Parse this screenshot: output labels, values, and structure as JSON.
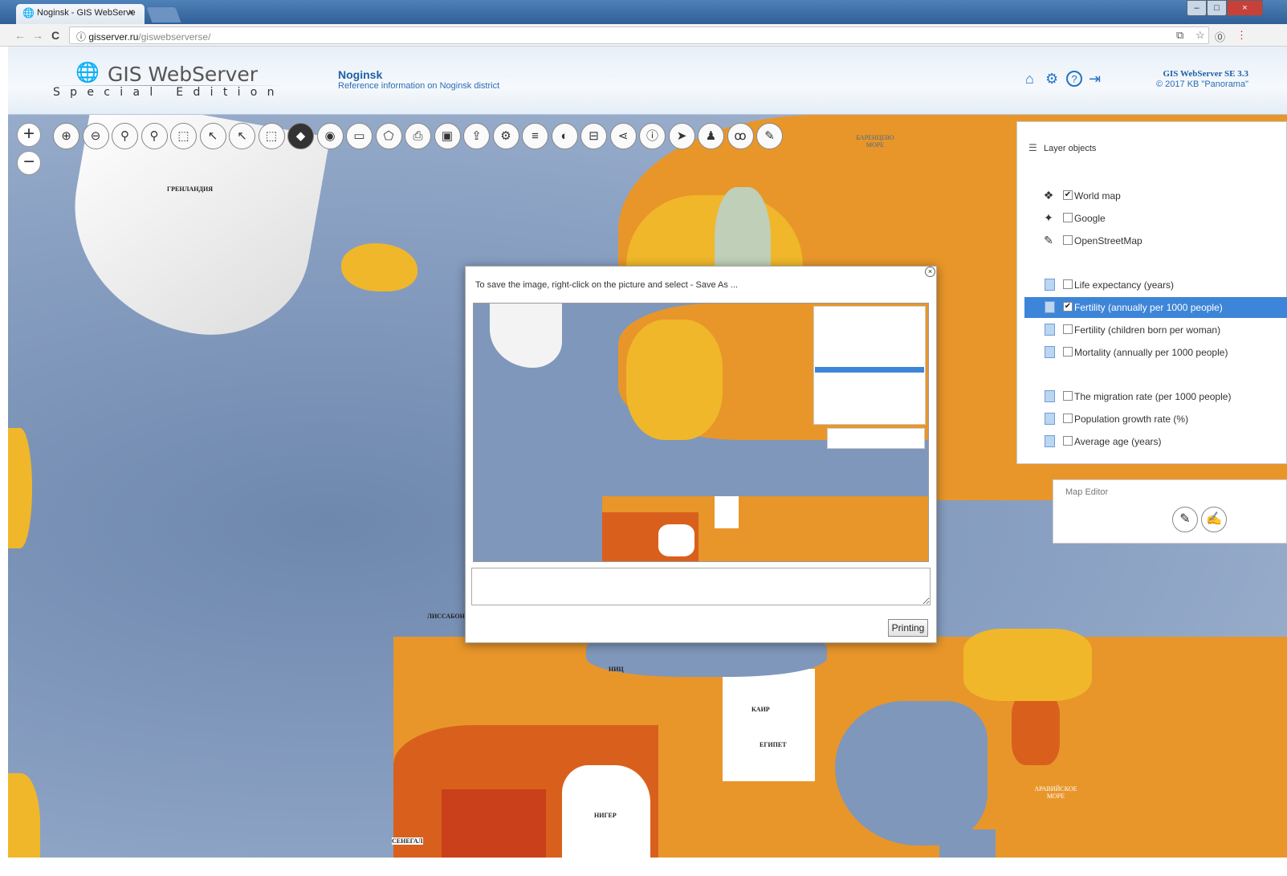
{
  "browser": {
    "tab_title": "Noginsk - GIS WebServe",
    "tab_icon": "map-globe-icon",
    "tab_close": "×",
    "url_host": "gisserver.ru",
    "url_path": "/giswebserverse/",
    "back": "←",
    "forward": "→",
    "reload": "C",
    "info": "ⓘ",
    "ext": "⧉",
    "star": "☆",
    "pin": "⓪",
    "menu": "⋮",
    "win_min": "–",
    "win_max": "□",
    "win_close": "×"
  },
  "header": {
    "logo_text": "GIS WebServer",
    "logo_sub": "Special Edition",
    "project_title": "Noginsk",
    "project_subtitle": "Reference information on Noginsk district",
    "icons": [
      "home-icon",
      "gear-icon",
      "help-icon",
      "logout-icon"
    ],
    "icon_glyphs": [
      "⌂",
      "⚙",
      "?",
      "⇥"
    ],
    "version_title": "GIS WebServer SE 3.3",
    "version_copyright": "© 2017 KB \"Panorama\""
  },
  "map": {
    "zoom_in": "+",
    "zoom_out": "−",
    "labels": {
      "greenland": "ГРЕНЛАНДИЯ",
      "barents": "БАРЕНЦЕВО МОРЕ",
      "lisbon": "ЛИССАБОН",
      "nice": "НИЦ",
      "cairo": "КАИР",
      "egypt": "ЕГИПЕТ",
      "niger": "НИГЕР",
      "senegal": "СЕНЕГАЛ",
      "arabian_sea": "АРАВИЙСКОЕ МОРЕ"
    },
    "colors": {
      "ocean": "#7f97bb",
      "land_light": "#f0b72a",
      "land_mid": "#e8962a",
      "land_dark": "#d9601c",
      "land_red": "#c9401a"
    }
  },
  "toolbar": [
    {
      "name": "zoom-in-tool",
      "glyph": "⊕"
    },
    {
      "name": "zoom-out-tool",
      "glyph": "⊖"
    },
    {
      "name": "zoom-window-tool",
      "glyph": "⚲"
    },
    {
      "name": "zoom-extent-tool",
      "glyph": "⚲"
    },
    {
      "name": "select-tool",
      "glyph": "⬚"
    },
    {
      "name": "select-point-tool",
      "glyph": "↖"
    },
    {
      "name": "select-area-tool",
      "glyph": "↖"
    },
    {
      "name": "clear-selection-tool",
      "glyph": "⬚"
    },
    {
      "name": "layers-tool",
      "glyph": "◆",
      "active": true
    },
    {
      "name": "locate-tool",
      "glyph": "◉"
    },
    {
      "name": "ruler-tool",
      "glyph": "▭"
    },
    {
      "name": "area-measure-tool",
      "glyph": "⬠"
    },
    {
      "name": "print-tool",
      "glyph": "⎙"
    },
    {
      "name": "image-export-tool",
      "glyph": "▣"
    },
    {
      "name": "share-tool",
      "glyph": "⇪"
    },
    {
      "name": "settings-tool",
      "glyph": "⚙"
    },
    {
      "name": "legend-tool",
      "glyph": "≡"
    },
    {
      "name": "thematic-tool",
      "glyph": "◐"
    },
    {
      "name": "bookmark-tool",
      "glyph": "⊟"
    },
    {
      "name": "network-tool",
      "glyph": "⋖"
    },
    {
      "name": "info-tool",
      "glyph": "ⓘ"
    },
    {
      "name": "navigate-tool",
      "glyph": "➤"
    },
    {
      "name": "users-tool",
      "glyph": "♟"
    },
    {
      "name": "route-tool",
      "glyph": "ꝏ"
    },
    {
      "name": "edit-tool",
      "glyph": "✎"
    }
  ],
  "layers_panel": {
    "title": "Layer objects",
    "title_icon": "☰",
    "items": [
      {
        "label": "World map",
        "checked": true,
        "icon": "globe-icon",
        "glyph": "❖",
        "selected": false
      },
      {
        "label": "Google",
        "checked": false,
        "icon": "google-maps-icon",
        "glyph": "✦",
        "selected": false
      },
      {
        "label": "OpenStreetMap",
        "checked": false,
        "icon": "osm-icon",
        "glyph": "✎",
        "selected": false
      },
      {
        "label": "Life expectancy (years)",
        "checked": false,
        "icon": "document-icon",
        "selected": false
      },
      {
        "label": "Fertility (annually per 1000 people)",
        "checked": true,
        "icon": "document-icon",
        "selected": true
      },
      {
        "label": "Fertility (children born per woman)",
        "checked": false,
        "icon": "document-icon",
        "selected": false
      },
      {
        "label": "Mortality (annually per 1000 people)",
        "checked": false,
        "icon": "document-icon",
        "selected": false
      },
      {
        "label": "The migration rate (per 1000 people)",
        "checked": false,
        "icon": "document-icon",
        "selected": false
      },
      {
        "label": "Population growth rate (%)",
        "checked": false,
        "icon": "document-icon",
        "selected": false
      },
      {
        "label": "Average age (years)",
        "checked": false,
        "icon": "document-icon",
        "selected": false
      }
    ]
  },
  "map_editor": {
    "title": "Map Editor",
    "buttons": [
      {
        "name": "edit-pencil-button",
        "glyph": "✎"
      },
      {
        "name": "edit-object-button",
        "glyph": "✍"
      }
    ]
  },
  "print_dialog": {
    "message": "To save the image, right-click on the picture and select - Save As ...",
    "close": "×",
    "textarea_value": "",
    "print_button": "Printing"
  }
}
